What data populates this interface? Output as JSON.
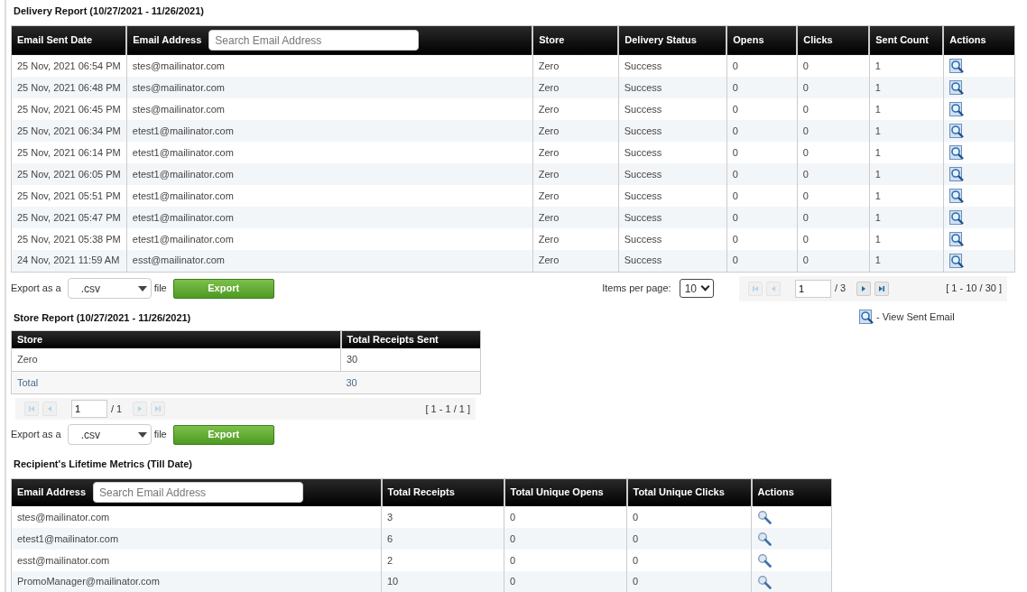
{
  "delivery_report": {
    "title": "Delivery Report (10/27/2021 - 11/26/2021)",
    "columns": [
      "Email Sent Date",
      "Email Address",
      "Store",
      "Delivery Status",
      "Opens",
      "Clicks",
      "Sent Count",
      "Actions"
    ],
    "search": {
      "placeholder": "Search Email Address"
    },
    "rows": [
      [
        "25 Nov, 2021 06:54 PM",
        "stes@mailinator.com",
        "Zero",
        "Success",
        "0",
        "0",
        "1"
      ],
      [
        "25 Nov, 2021 06:48 PM",
        "stes@mailinator.com",
        "Zero",
        "Success",
        "0",
        "0",
        "1"
      ],
      [
        "25 Nov, 2021 06:45 PM",
        "stes@mailinator.com",
        "Zero",
        "Success",
        "0",
        "0",
        "1"
      ],
      [
        "25 Nov, 2021 06:34 PM",
        "etest1@mailinator.com",
        "Zero",
        "Success",
        "0",
        "0",
        "1"
      ],
      [
        "25 Nov, 2021 06:14 PM",
        "etest1@mailinator.com",
        "Zero",
        "Success",
        "0",
        "0",
        "1"
      ],
      [
        "25 Nov, 2021 06:05 PM",
        "etest1@mailinator.com",
        "Zero",
        "Success",
        "0",
        "0",
        "1"
      ],
      [
        "25 Nov, 2021 05:51 PM",
        "etest1@mailinator.com",
        "Zero",
        "Success",
        "0",
        "0",
        "1"
      ],
      [
        "25 Nov, 2021 05:47 PM",
        "etest1@mailinator.com",
        "Zero",
        "Success",
        "0",
        "0",
        "1"
      ],
      [
        "25 Nov, 2021 05:38 PM",
        "etest1@mailinator.com",
        "Zero",
        "Success",
        "0",
        "0",
        "1"
      ],
      [
        "24 Nov, 2021 11:59 AM",
        "esst@mailinator.com",
        "Zero",
        "Success",
        "0",
        "0",
        "1"
      ]
    ],
    "export": {
      "label_before": "Export as a",
      "format": ".csv",
      "label_after": "file",
      "button": "Export"
    },
    "items_per_page": {
      "label": "Items per page:",
      "value": "10"
    },
    "pager": {
      "buttons_before": [
        {
          "kind": "first",
          "disabled": true
        },
        {
          "kind": "prev",
          "disabled": true
        }
      ],
      "page": "1",
      "total": "/ 3",
      "buttons_after": [
        {
          "kind": "next",
          "disabled": false
        },
        {
          "kind": "last",
          "disabled": false
        }
      ],
      "range": "[ 1 - 10 / 30 ]"
    }
  },
  "legend": {
    "text": "- View Sent Email"
  },
  "store_report": {
    "title": "Store Report (10/27/2021 - 11/26/2021)",
    "columns": [
      "Store",
      "Total Receipts Sent"
    ],
    "rows": [
      [
        "Zero",
        "30"
      ]
    ],
    "total": [
      "Total",
      "30"
    ],
    "pager": {
      "buttons_before": [
        {
          "kind": "first",
          "disabled": true
        },
        {
          "kind": "prev",
          "disabled": true
        }
      ],
      "page": "1",
      "total": "/ 1",
      "buttons_after": [
        {
          "kind": "next",
          "disabled": true
        },
        {
          "kind": "last",
          "disabled": true
        }
      ],
      "range": "[ 1 - 1 / 1 ]"
    },
    "export": {
      "label_before": "Export as a",
      "format": ".csv",
      "label_after": "file",
      "button": "Export"
    }
  },
  "recipient_metrics": {
    "title": "Recipient's Lifetime Metrics (Till Date)",
    "columns": [
      "Email Address",
      "Total Receipts",
      "Total Unique Opens",
      "Total Unique Clicks",
      "Actions"
    ],
    "search": {
      "placeholder": "Search Email Address"
    },
    "rows": [
      [
        "stes@mailinator.com",
        "3",
        "0",
        "0"
      ],
      [
        "etest1@mailinator.com",
        "6",
        "0",
        "0"
      ],
      [
        "esst@mailinator.com",
        "2",
        "0",
        "0"
      ],
      [
        "PromoManager@mailinator.com",
        "10",
        "0",
        "0"
      ]
    ]
  }
}
